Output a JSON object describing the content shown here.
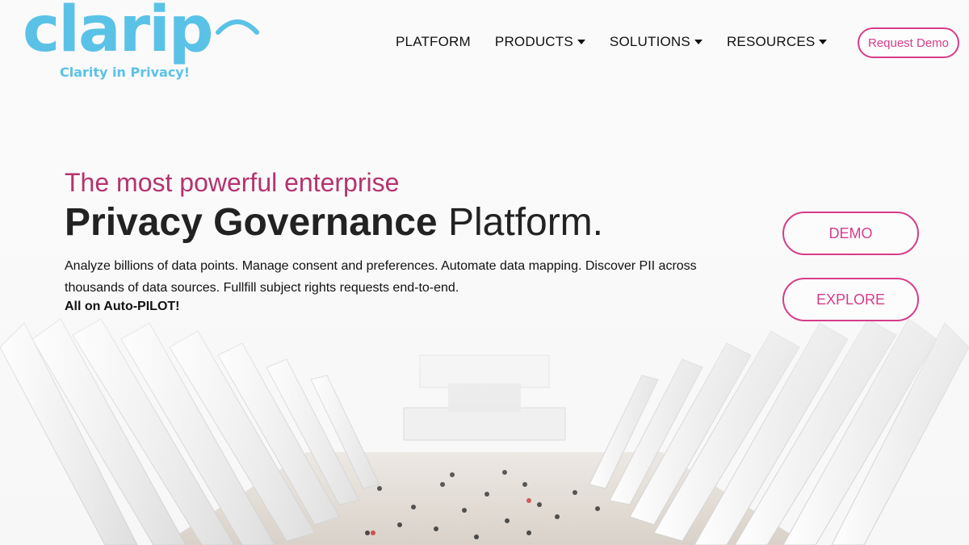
{
  "brand": {
    "logo_word": "clarip",
    "tagline": "Clarity in Privacy!",
    "logo_color": "#5bc2e7"
  },
  "nav": {
    "items": [
      {
        "label": "PLATFORM",
        "has_dropdown": false
      },
      {
        "label": "PRODUCTS",
        "has_dropdown": true
      },
      {
        "label": "SOLUTIONS",
        "has_dropdown": true
      },
      {
        "label": "RESOURCES",
        "has_dropdown": true
      }
    ],
    "request_demo": "Request Demo"
  },
  "hero": {
    "subtitle": "The most powerful enterprise",
    "title_bold": "Privacy Governance",
    "title_rest": " Platform.",
    "description": "Analyze billions of data points. Manage consent and preferences. Automate data mapping. Discover PII across thousands of data sources. Fullfill subject rights requests end-to-end.",
    "tagline": "All on Auto-PILOT!"
  },
  "cta": {
    "demo": "DEMO",
    "explore": "EXPLORE"
  },
  "colors": {
    "accent": "#d63d8a",
    "subtitle": "#b5336f"
  },
  "icons": [
    "caret-down-icon",
    "wifi-arc-icon"
  ]
}
